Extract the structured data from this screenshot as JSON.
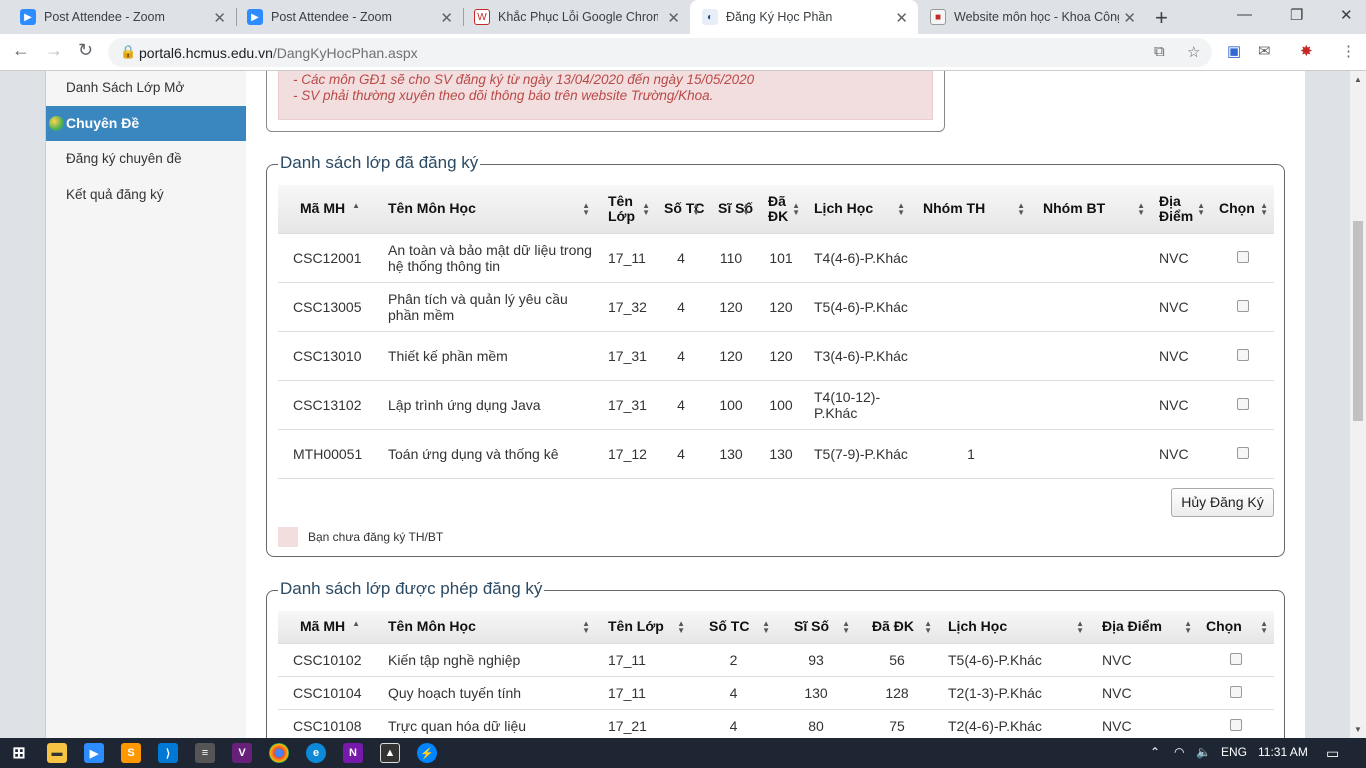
{
  "tabs": [
    {
      "title": "Post Attendee - Zoom",
      "icon": "zoom-icon"
    },
    {
      "title": "Post Attendee - Zoom",
      "icon": "zoom-icon"
    },
    {
      "title": "Khắc Phục Lỗi Google Chrome",
      "icon": "site-icon"
    },
    {
      "title": "Đăng Ký Học Phần",
      "icon": "hcmus-icon"
    },
    {
      "title": "Website môn học - Khoa Công",
      "icon": "site-icon"
    }
  ],
  "url": {
    "host": "portal6.hcmus.edu.vn",
    "path": "/DangKyHocPhan.aspx"
  },
  "sidebar": {
    "item_open_classes": "Danh Sách Lớp Mở",
    "section_title": "Chuyên Đề",
    "item_register_topic": "Đăng ký chuyên đề",
    "item_result": "Kết quả đăng ký"
  },
  "notice": {
    "line1": "- Các môn GĐ1 sẽ cho SV đăng ký từ ngày 13/04/2020 đến ngày 15/05/2020",
    "line2": "- SV phải thường xuyên theo dõi thông báo trên website Trường/Khoa."
  },
  "registered": {
    "legend": "Danh sách lớp đã đăng ký",
    "headers": [
      "Mã MH",
      "Tên Môn Học",
      "Tên Lớp",
      "Số TC",
      "Sĩ Số",
      "Đã ĐK",
      "Lịch Học",
      "Nhóm TH",
      "Nhóm BT",
      "Địa Điểm",
      "Chọn"
    ],
    "rows": [
      {
        "code": "CSC12001",
        "name": "An toàn và bảo mật dữ liệu trong hệ thống thông tin",
        "class": "17_11",
        "credits": "4",
        "size": "110",
        "registered": "101",
        "schedule": "T4(4-6)-P.Khác",
        "lab_group": "",
        "ex_group": "",
        "location": "NVC"
      },
      {
        "code": "CSC13005",
        "name": "Phân tích và quản lý yêu cầu phần mềm",
        "class": "17_32",
        "credits": "4",
        "size": "120",
        "registered": "120",
        "schedule": "T5(4-6)-P.Khác",
        "lab_group": "",
        "ex_group": "",
        "location": "NVC"
      },
      {
        "code": "CSC13010",
        "name": "Thiết kế phần mềm",
        "class": "17_31",
        "credits": "4",
        "size": "120",
        "registered": "120",
        "schedule": "T3(4-6)-P.Khác",
        "lab_group": "",
        "ex_group": "",
        "location": "NVC"
      },
      {
        "code": "CSC13102",
        "name": "Lập trình ứng dụng Java",
        "class": "17_31",
        "credits": "4",
        "size": "100",
        "registered": "100",
        "schedule": "T4(10-12)-P.Khác",
        "lab_group": "",
        "ex_group": "",
        "location": "NVC"
      },
      {
        "code": "MTH00051",
        "name": "Toán ứng dụng và thống kê",
        "class": "17_12",
        "credits": "4",
        "size": "130",
        "registered": "130",
        "schedule": "T5(7-9)-P.Khác",
        "lab_group": "1",
        "ex_group": "",
        "location": "NVC"
      }
    ],
    "cancel_button": "Hủy Đăng Ký",
    "legend_note": "Bạn chưa đăng ký TH/BT"
  },
  "allowed": {
    "legend": "Danh sách lớp được phép đăng ký",
    "headers": [
      "Mã MH",
      "Tên Môn Học",
      "Tên Lớp",
      "Số TC",
      "Sĩ Số",
      "Đã ĐK",
      "Lịch Học",
      "Địa Điểm",
      "Chọn"
    ],
    "rows": [
      {
        "code": "CSC10102",
        "name": "Kiến tập nghề nghiệp",
        "class": "17_11",
        "credits": "2",
        "size": "93",
        "registered": "56",
        "schedule": "T5(4-6)-P.Khác",
        "location": "NVC"
      },
      {
        "code": "CSC10104",
        "name": "Quy hoạch tuyến tính",
        "class": "17_11",
        "credits": "4",
        "size": "130",
        "registered": "128",
        "schedule": "T2(1-3)-P.Khác",
        "location": "NVC"
      },
      {
        "code": "CSC10108",
        "name": "Trực quan hóa dữ liệu",
        "class": "17_21",
        "credits": "4",
        "size": "80",
        "registered": "75",
        "schedule": "T2(4-6)-P.Khác",
        "location": "NVC"
      }
    ]
  },
  "taskbar": {
    "lang": "ENG",
    "time": "11:31 AM"
  }
}
